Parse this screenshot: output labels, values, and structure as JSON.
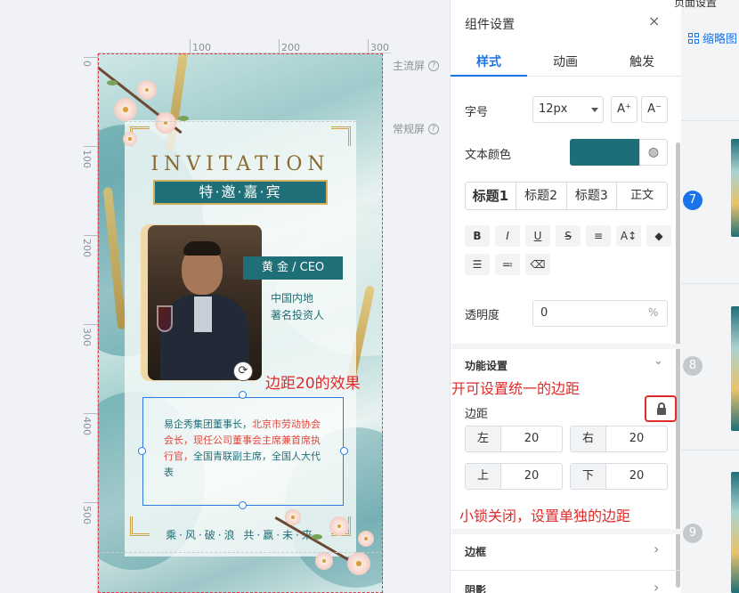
{
  "workspace": {
    "ruler_top": [
      "100",
      "200",
      "300"
    ],
    "ruler_left": [
      "0",
      "100",
      "200",
      "300",
      "400",
      "500"
    ],
    "screen_main": "主流屏",
    "screen_normal": "常规屏",
    "help_glyph": "?"
  },
  "card": {
    "title": "INVITATION",
    "ribbon": "特·邀·嘉·宾",
    "name": "黄 金 / CEO",
    "subtitle_line1": "中国内地",
    "subtitle_line2": "著名投资人",
    "bio_part1": "易企秀集团董事长，",
    "bio_part2": "北京市劳动协会会长，现任公司董事会主席兼首席执行官，",
    "bio_part3": "全国青联副主席，全国人大代表",
    "footer": "乘·风·破·浪 共·赢·未·来",
    "refresh_glyph": "⟳"
  },
  "annotations": {
    "margin_effect": "边距20的效果",
    "lock_open": "小锁打开可设置统一的边距",
    "lock_closed": "小锁关闭，设置单独的边距"
  },
  "panel": {
    "title": "组件设置",
    "close_glyph": "×",
    "tabs": [
      "样式",
      "动画",
      "触发"
    ],
    "font_size_label": "字号",
    "font_size_value": "12px",
    "font_inc": "A⁺",
    "font_dec": "A⁻",
    "text_color_label": "文本颜色",
    "text_color": "#1c6e79",
    "palette_glyph": "◍",
    "headings": [
      "标题1",
      "标题2",
      "标题3",
      "正文"
    ],
    "format_row1": [
      "B",
      "I",
      "U",
      "S",
      "≡",
      "A↕",
      "◆"
    ],
    "format_row2": [
      "☰",
      "≕",
      "⌫"
    ],
    "opacity_label": "透明度",
    "opacity_value": "0",
    "opacity_unit": "%",
    "function_section": "功能设置",
    "margin_label": "边距",
    "margins": [
      {
        "label": "左",
        "value": "20"
      },
      {
        "label": "右",
        "value": "20"
      },
      {
        "label": "上",
        "value": "20"
      },
      {
        "label": "下",
        "value": "20"
      }
    ],
    "border_section": "边框",
    "shadow_section": "阴影",
    "chevron_down": "⌄",
    "chevron_right": "›"
  },
  "thumbnails": {
    "top_label": "页面设置",
    "toggle_label": "缩略图",
    "pages": [
      "7",
      "8",
      "9"
    ],
    "active_color": "#1a73e8",
    "inactive_color": "#c5c8cd"
  }
}
